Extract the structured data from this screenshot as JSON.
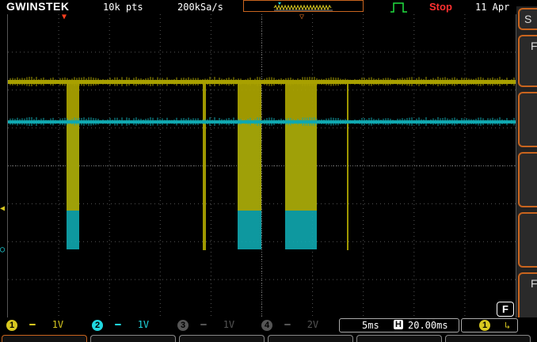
{
  "header": {
    "brand": "GWINSTEK",
    "record_length": "10k pts",
    "sample_rate": "200kSa/s",
    "run_state": "Stop",
    "date": "11 Apr"
  },
  "channels": [
    {
      "num": "1",
      "coupling_icon": "dc-coupling-icon",
      "scale": "1V",
      "color": "#d8c820",
      "active": true
    },
    {
      "num": "2",
      "coupling_icon": "dc-coupling-icon",
      "scale": "1V",
      "color": "#20d8e0",
      "active": true
    },
    {
      "num": "3",
      "coupling_icon": "dc-coupling-icon",
      "scale": "1V",
      "color": "#555555",
      "active": false
    },
    {
      "num": "4",
      "coupling_icon": "dc-coupling-icon",
      "scale": "2V",
      "color": "#555555",
      "active": false
    }
  ],
  "timebase": {
    "scale": "5ms",
    "position_icon": "horizontal-position-icon",
    "position": "20.00ms"
  },
  "trigger": {
    "source": "1",
    "slope_icon": "falling-edge-icon"
  },
  "softkeys": [
    {
      "label": "S"
    },
    {
      "label": "F"
    },
    {
      "label": ""
    },
    {
      "label": ""
    },
    {
      "label": ""
    },
    {
      "label": "F"
    }
  ],
  "function_key": "F",
  "colors": {
    "ch1": "#a8a000",
    "ch2": "#10a8b0",
    "accent": "#c8641e",
    "stop": "#ff3030"
  }
}
